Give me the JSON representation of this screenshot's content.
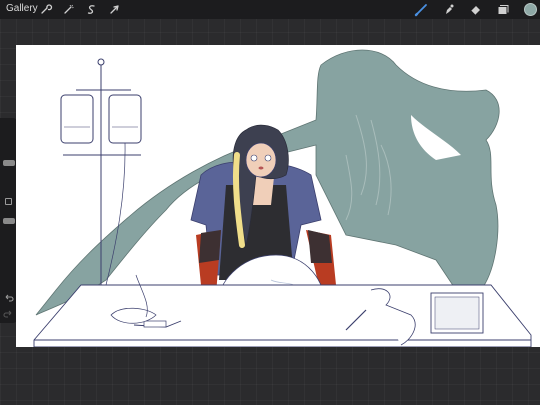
{
  "topbar": {
    "gallery_label": "Gallery",
    "left_tools": [
      {
        "icon": "wrench-icon",
        "name": "actions"
      },
      {
        "icon": "magic-wand-icon",
        "name": "adjustments"
      },
      {
        "icon": "selection-icon",
        "name": "selection"
      },
      {
        "icon": "arrow-cursor-icon",
        "name": "transform"
      }
    ],
    "right_tools": [
      {
        "icon": "brush-icon",
        "name": "paint",
        "active": true
      },
      {
        "icon": "smudge-icon",
        "name": "smudge"
      },
      {
        "icon": "eraser-icon",
        "name": "eraser"
      },
      {
        "icon": "layers-icon",
        "name": "layers"
      }
    ],
    "current_color": "#8ea8a6",
    "active_tool_color": "#4a90e2"
  },
  "sidebar": {
    "controls": [
      "brush-size-slider",
      "modify-button",
      "opacity-slider",
      "undo-icon",
      "redo-icon"
    ]
  },
  "canvas": {
    "palette": {
      "ghost": "#87a3a1",
      "outfit": "#5a6498",
      "apron": "#2d2d31",
      "gloves": "#b93c22",
      "hair_dark": "#3d4050",
      "hair_light": "#f0de8a",
      "skin": "#f0cfb9",
      "lineart": "#3b3f6d"
    }
  }
}
